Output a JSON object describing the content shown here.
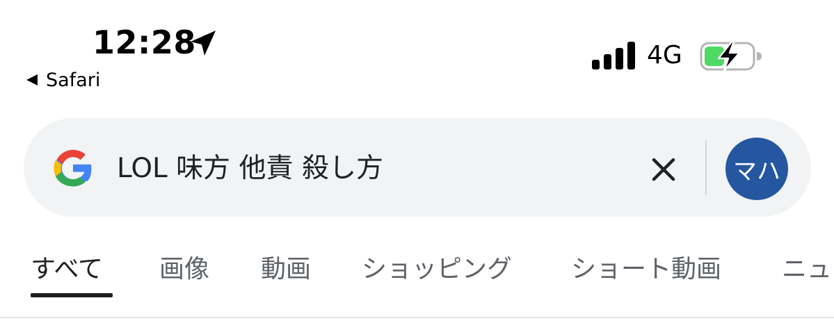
{
  "status_bar": {
    "time": "12:28",
    "location_icon": "location-arrow-icon",
    "back_app_label": "Safari",
    "network": "4G",
    "signal_icon": "cellular-signal-icon",
    "battery_icon": "battery-charging-icon",
    "battery_color": "#4cd964"
  },
  "search": {
    "logo_icon": "google-g-icon",
    "query": "LOL 味方 他責 殺し方",
    "clear_icon": "close-icon",
    "avatar_text": "マハ",
    "avatar_color": "#2457a0"
  },
  "tabs": [
    {
      "label": "すべて",
      "active": true
    },
    {
      "label": "画像",
      "active": false
    },
    {
      "label": "動画",
      "active": false
    },
    {
      "label": "ショッピング",
      "active": false
    },
    {
      "label": "ショート動画",
      "active": false
    },
    {
      "label": "ニュ",
      "active": false
    }
  ]
}
